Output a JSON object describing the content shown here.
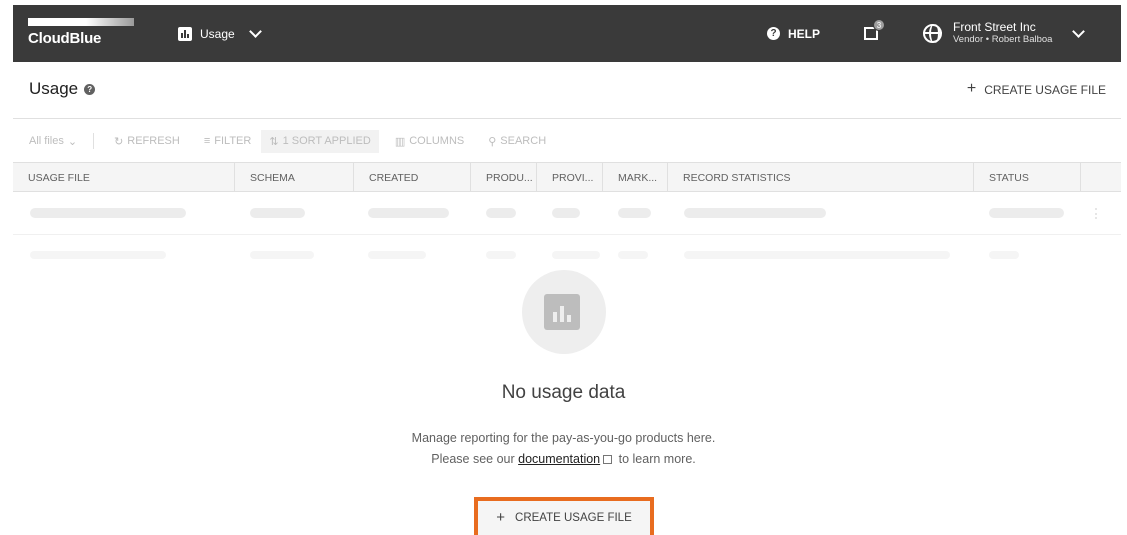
{
  "topbar": {
    "logo_text": "CloudBlue",
    "module_label": "Usage",
    "help_label": "HELP",
    "notification_count": "3",
    "account_name": "Front Street Inc",
    "account_sub": "Vendor • Robert Balboa"
  },
  "page": {
    "title": "Usage",
    "create_label": "CREATE USAGE FILE"
  },
  "toolbar": {
    "files_filter": "All files",
    "refresh_label": "REFRESH",
    "filter_label": "FILTER",
    "sort_label": "1 SORT APPLIED",
    "columns_label": "COLUMNS",
    "search_label": "SEARCH"
  },
  "table": {
    "columns": [
      "USAGE FILE",
      "SCHEMA",
      "CREATED",
      "PRODU...",
      "PROVI...",
      "MARK...",
      "RECORD STATISTICS",
      "STATUS"
    ]
  },
  "empty_state": {
    "title": "No usage data",
    "line1": "Manage reporting for the pay-as-you-go products here.",
    "line2_pre": "Please see our",
    "link_text": "documentation",
    "line2_post": "to learn more.",
    "button_label": "CREATE USAGE FILE"
  },
  "colors": {
    "topbar": "#3a3a3a",
    "highlight": "#e86c1f"
  }
}
